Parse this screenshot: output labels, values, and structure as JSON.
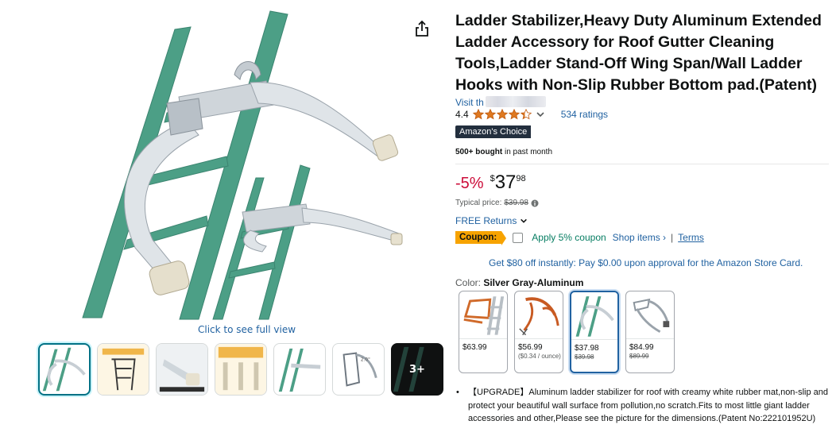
{
  "gallery": {
    "full_view_label": "Click to see full view",
    "thumb_more_label": "3+",
    "thumb_count": 7
  },
  "product": {
    "title": "Ladder Stabilizer,Heavy Duty Aluminum Extended Ladder Accessory for Roof Gutter Cleaning Tools,Ladder Stand-Off Wing Span/Wall Ladder Hooks with Non-Slip Rubber Bottom pad.(Patent)",
    "visit_store_label": "Visit th",
    "rating_value": "4.4",
    "rating_stars": 4.4,
    "ratings_count_label": "534 ratings",
    "choice_badge": "Amazon's Choice",
    "bought_bold": "500+ bought",
    "bought_rest": " in past month"
  },
  "price": {
    "discount": "-5%",
    "symbol": "$",
    "whole": "37",
    "fraction": "98",
    "typical_label": "Typical price:",
    "typical_value": "$39.98"
  },
  "returns": {
    "label": "FREE Returns"
  },
  "coupon": {
    "badge": "Coupon:",
    "text": "Apply 5% coupon",
    "shop_items": "Shop items ›",
    "separator": "|",
    "terms": "Terms"
  },
  "store_card": {
    "text": "Get $80 off instantly: Pay $0.00 upon approval for the Amazon Store Card."
  },
  "color": {
    "label": "Color: ",
    "selected": "Silver Gray-Aluminum",
    "swatches": [
      {
        "price": "$63.99",
        "sub": "",
        "strike": ""
      },
      {
        "price": "$56.99",
        "sub": "($0.34 / ounce)",
        "strike": ""
      },
      {
        "price": "$37.98",
        "sub": "",
        "strike": "$39.98"
      },
      {
        "price": "$84.99",
        "sub": "",
        "strike": "$89.99"
      }
    ],
    "selected_index": 2
  },
  "bullets": [
    "【UPGRADE】Aluminum ladder stabilizer for roof with creamy white rubber mat,non-slip and protect your beautiful wall surface from pollution,no scratch.Fits to most little giant ladder accessories and other,Please see the picture for the dimensions.(Patent No:222101952U)"
  ],
  "colors": {
    "link": "#2162a1",
    "deal_red": "#cc0c39",
    "coupon_orange": "#f7a300",
    "coupon_green": "#067d62",
    "star": "#de7921",
    "ladder_green": "#4c9f86"
  }
}
